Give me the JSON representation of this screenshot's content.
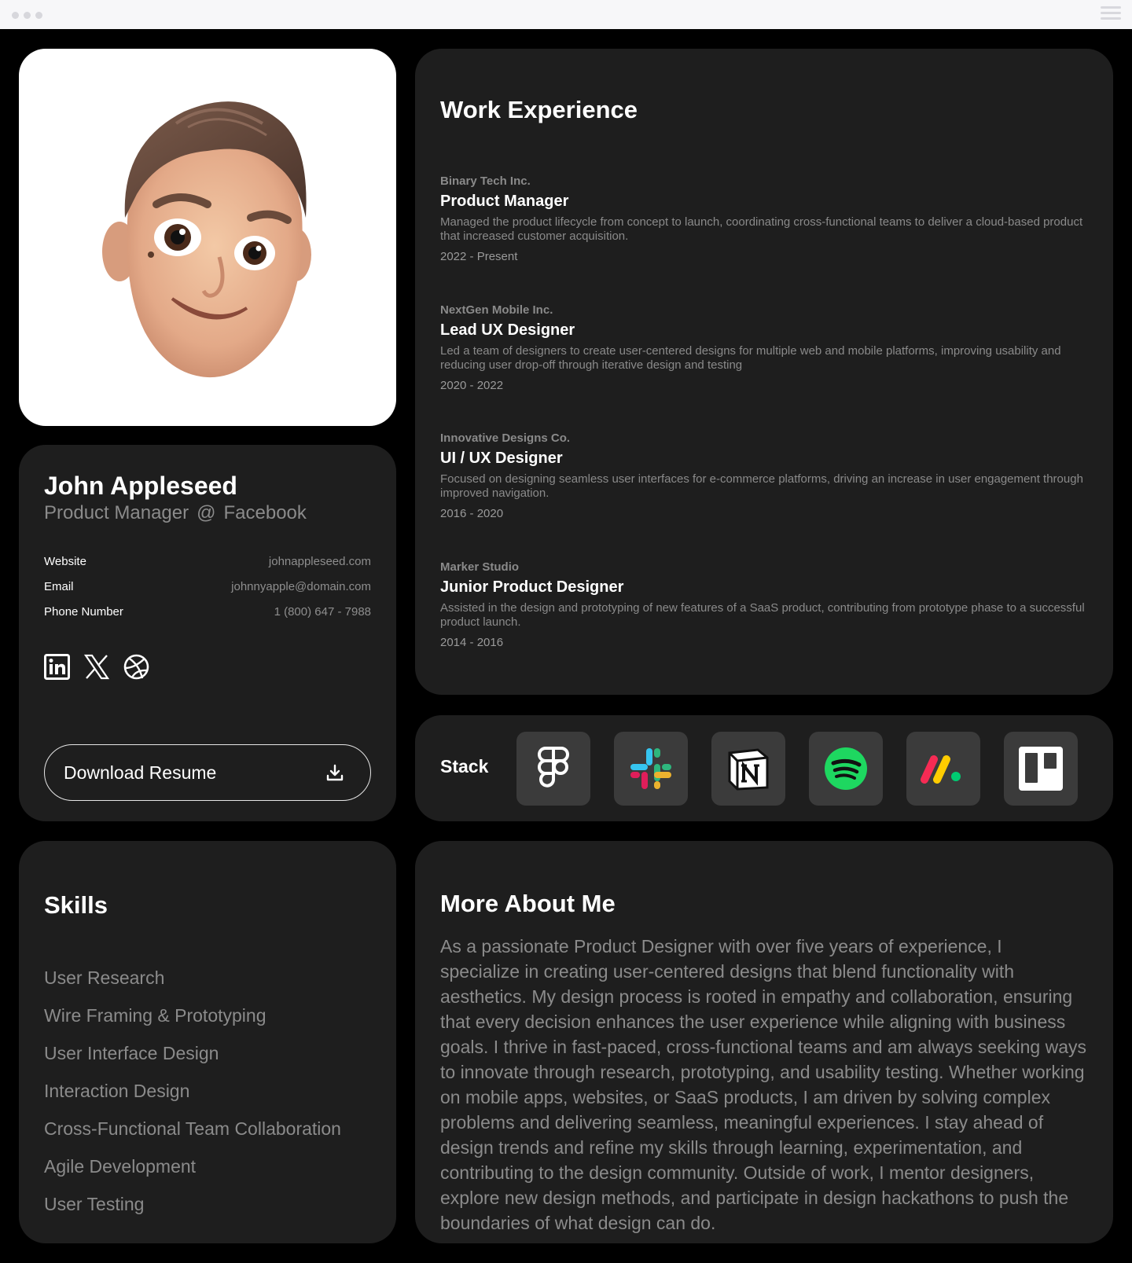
{
  "profile": {
    "name": "John Appleseed",
    "title": "Product Manager",
    "at": "@",
    "company": "Facebook",
    "info": [
      {
        "label": "Website",
        "value": "johnappleseed.com"
      },
      {
        "label": "Email",
        "value": "johnnyapple@domain.com"
      },
      {
        "label": "Phone Number",
        "value": "1 (800) 647 - 7988"
      }
    ],
    "socials": [
      "linkedin-icon",
      "x-icon",
      "dribbble-icon"
    ],
    "download_label": "Download Resume"
  },
  "work": {
    "title": "Work Experience",
    "jobs": [
      {
        "company": "Binary Tech Inc.",
        "role": "Product Manager",
        "desc": "Managed the product lifecycle from concept to launch, coordinating cross-functional teams to deliver a cloud-based product that increased customer acquisition.",
        "years": "2022 - Present"
      },
      {
        "company": "NextGen Mobile Inc.",
        "role": "Lead UX Designer",
        "desc": "Led a team of designers to create user-centered designs for multiple web and mobile platforms, improving usability and reducing user drop-off through iterative design and testing",
        "years": "2020 - 2022"
      },
      {
        "company": "Innovative Designs Co.",
        "role": "UI / UX Designer",
        "desc": "Focused on designing seamless user interfaces for e-commerce platforms, driving an increase in user engagement through improved navigation.",
        "years": "2016 - 2020"
      },
      {
        "company": "Marker Studio",
        "role": "Junior Product Designer",
        "desc": "Assisted in the design and prototyping of new features of a SaaS product, contributing from prototype phase to a successful product launch.",
        "years": "2014 - 2016"
      }
    ]
  },
  "stack": {
    "title": "Stack",
    "tools": [
      "figma-icon",
      "slack-icon",
      "notion-icon",
      "spotify-icon",
      "monday-icon",
      "trello-icon"
    ]
  },
  "skills": {
    "title": "Skills",
    "items": [
      "User Research",
      "Wire Framing & Prototyping",
      "User Interface Design",
      "Interaction Design",
      "Cross-Functional Team Collaboration",
      "Agile Development",
      "User Testing"
    ]
  },
  "about": {
    "title": "More About Me",
    "text": "As a passionate Product Designer with over five years of experience, I specialize in creating user-centered designs that blend functionality with aesthetics. My design process is rooted in empathy and collaboration, ensuring that every decision enhances the user experience while aligning with business goals. I thrive in fast-paced, cross-functional teams and am always seeking ways to innovate through research, prototyping, and usability testing. Whether working on mobile apps, websites, or SaaS products, I am driven by solving complex problems and delivering seamless, meaningful experiences. I stay ahead of design trends and refine my skills through learning, experimentation, and contributing to the design community. Outside of work, I mentor designers, explore new design methods, and participate in design hackathons to push the boundaries of what design can do."
  }
}
